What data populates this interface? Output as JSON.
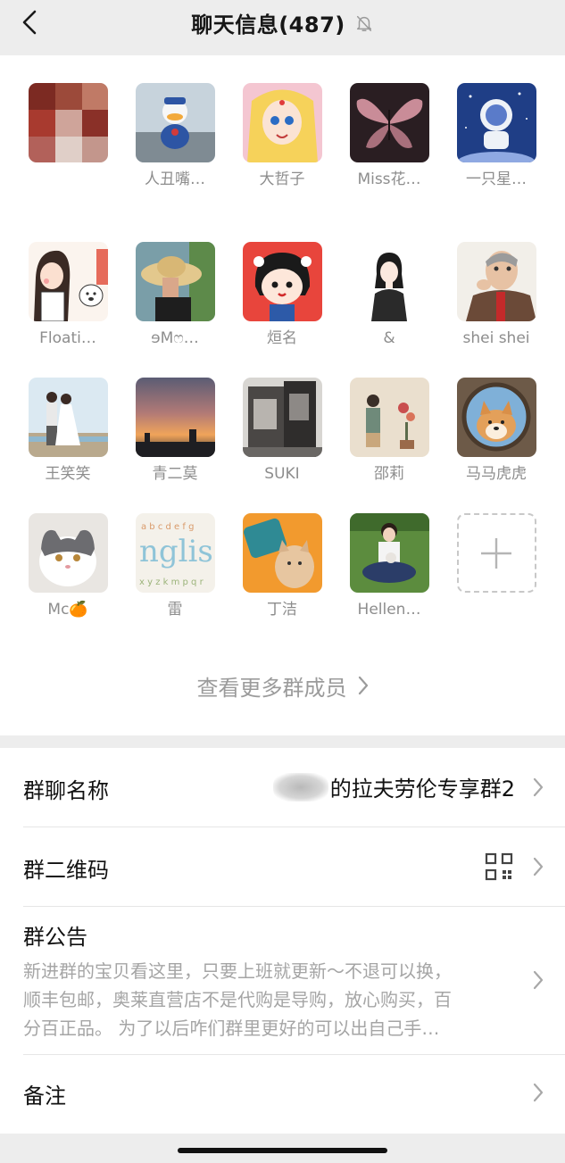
{
  "header": {
    "title": "聊天信息(487)",
    "back_icon": "chevron-left-icon",
    "mute_icon": "bell-muted-icon"
  },
  "members": [
    {
      "name": "",
      "avatar": "blurred"
    },
    {
      "name": "人丑嘴…",
      "avatar": "donald-duck"
    },
    {
      "name": "大哲子",
      "avatar": "sailor-moon"
    },
    {
      "name": "Miss花…",
      "avatar": "butterfly"
    },
    {
      "name": "一只星…",
      "avatar": "astronaut"
    },
    {
      "name": "Floati…",
      "avatar": "couple-dog"
    },
    {
      "name": "ɘMෆ…",
      "avatar": "sunhat-girl"
    },
    {
      "name": "烜名",
      "avatar": "peko-girl"
    },
    {
      "name": "&",
      "avatar": "sketch-girl"
    },
    {
      "name": "shei shei",
      "avatar": "old-man"
    },
    {
      "name": "王笑笑",
      "avatar": "wedding-couple"
    },
    {
      "name": "青二莫",
      "avatar": "sunset"
    },
    {
      "name": "SUKI",
      "avatar": "building"
    },
    {
      "name": "邵莉",
      "avatar": "flower-painting"
    },
    {
      "name": "马马虎虎",
      "avatar": "shiba-dog"
    },
    {
      "name": "Mc🍊",
      "avatar": "grey-cat"
    },
    {
      "name": "雷",
      "avatar": "english-letters"
    },
    {
      "name": "丁洁",
      "avatar": "cartoon-cat"
    },
    {
      "name": "Hellen…",
      "avatar": "girl-grass"
    }
  ],
  "add_member_icon": "plus-icon",
  "more_members": "查看更多群成员",
  "settings": {
    "group_name_label": "群聊名称",
    "group_name_value": "的拉夫劳伦专享群2",
    "qr_label": "群二维码",
    "qr_icon": "qr-code-icon",
    "notice_label": "群公告",
    "notice_lines": [
      "新进群的宝贝看这里，只要上班就更新～不退可以换，",
      "顺丰包邮，奥莱直营店不是代购是导购，放心购买，百",
      "分百正品。 为了以后咋们群里更好的可以出自己手…"
    ],
    "remark_label": "备注"
  }
}
